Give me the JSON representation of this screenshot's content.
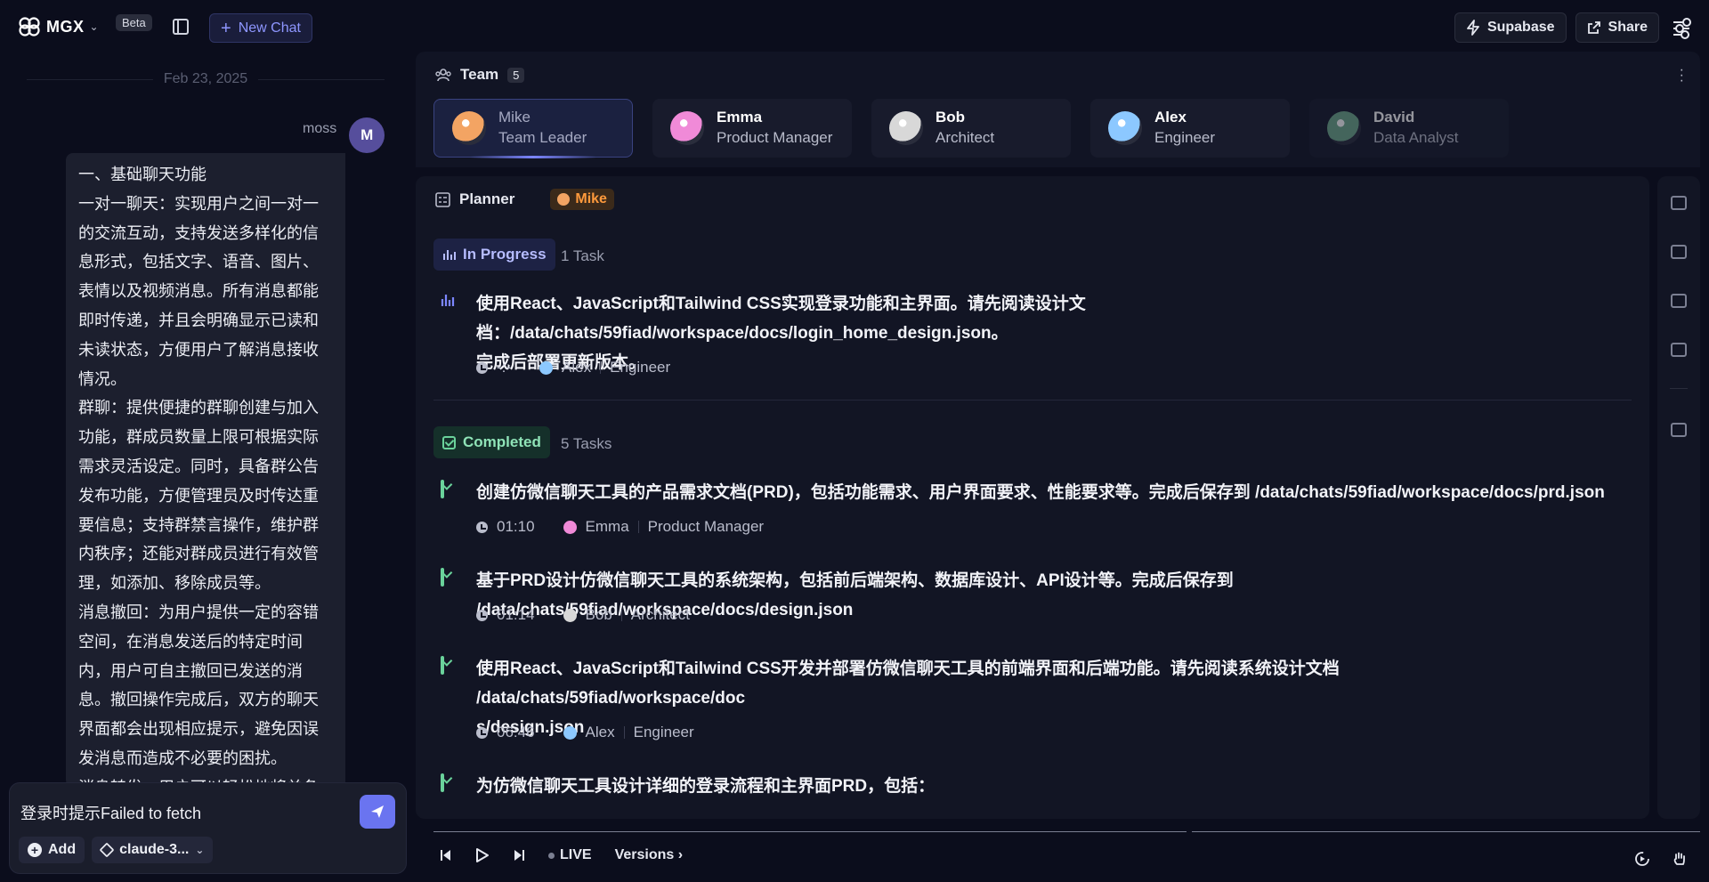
{
  "app": {
    "logo": "MGX",
    "beta": "Beta",
    "new_chat": "New Chat",
    "supabase": "Supabase",
    "share": "Share"
  },
  "chat": {
    "date": "Feb 23, 2025",
    "user_name": "moss",
    "avatar_initial": "M",
    "message_lines": [
      "一、基础聊天功能",
      "一对一聊天：实现用户之间一对一",
      "的交流互动，支持发送多样化的信",
      "息形式，包括文字、语音、图片、",
      "表情以及视频消息。所有消息都能",
      "即时传递，并且会明确显示已读和",
      "未读状态，方便用户了解消息接收",
      "情况。",
      "群聊：提供便捷的群聊创建与加入",
      "功能，群成员数量上限可根据实际",
      "需求灵活设定。同时，具备群公告",
      "发布功能，方便管理员及时传达重",
      "要信息；支持群禁言操作，维护群",
      "内秩序；还能对群成员进行有效管",
      "理，如添加、移除成员等。",
      "消息撤回：为用户提供一定的容错",
      "空间，在消息发送后的特定时间",
      "内，用户可自主撤回已发送的消",
      "息。撤回操作完成后，双方的聊天",
      "界面都会出现相应提示，避免因误",
      "发消息而造成不必要的困扰。",
      "消息转发：用户可以轻松地将单条"
    ],
    "composer_text": "登录时提示Failed to fetch",
    "add_label": "Add",
    "model_label": "claude-3..."
  },
  "team": {
    "title": "Team",
    "count": "5",
    "members": [
      {
        "name": "Mike",
        "role": "Team Leader",
        "color": "#f3a463"
      },
      {
        "name": "Emma",
        "role": "Product Manager",
        "color": "#f08ad8"
      },
      {
        "name": "Bob",
        "role": "Architect",
        "color": "#d8d8d8"
      },
      {
        "name": "Alex",
        "role": "Engineer",
        "color": "#8cc8ff"
      },
      {
        "name": "David",
        "role": "Data Analyst",
        "color": "#6fa88a"
      }
    ]
  },
  "planner": {
    "title": "Planner",
    "owner": "Mike",
    "in_progress": {
      "label": "In Progress",
      "count": "1 Task",
      "tasks": [
        {
          "lines": [
            "使用React、JavaScript和Tailwind CSS实现登录功能和主界面。请先阅读设计文档：/data/chats/59fiad/workspace/docs/login_home_design.json。",
            "完成后部署更新版本。"
          ],
          "time": "-:-",
          "assignee": "Alex",
          "role": "Engineer"
        }
      ]
    },
    "completed": {
      "label": "Completed",
      "count": "5 Tasks",
      "tasks": [
        {
          "lines": [
            "创建仿微信聊天工具的产品需求文档(PRD)，包括功能需求、用户界面要求、性能要求等。完成后保存到 /data/chats/59fiad/workspace/docs/prd.json"
          ],
          "time": "01:10",
          "assignee": "Emma",
          "role": "Product Manager"
        },
        {
          "lines": [
            "基于PRD设计仿微信聊天工具的系统架构，包括前后端架构、数据库设计、API设计等。完成后保存到 /data/chats/59fiad/workspace/docs/design.json"
          ],
          "time": "01:14",
          "assignee": "Bob",
          "role": "Architect"
        },
        {
          "lines": [
            "使用React、JavaScript和Tailwind CSS开发并部署仿微信聊天工具的前端界面和后端功能。请先阅读系统设计文档 /data/chats/59fiad/workspace/doc",
            "s/design.json"
          ],
          "time": "06:46",
          "assignee": "Alex",
          "role": "Engineer"
        },
        {
          "lines": [
            "为仿微信聊天工具设计详细的登录流程和主界面PRD，包括："
          ],
          "time": "",
          "assignee": "",
          "role": ""
        }
      ]
    }
  },
  "player": {
    "live": "LIVE",
    "versions": "Versions"
  },
  "colors": {
    "accent": "#6a74f0",
    "completed": "#6ad29b",
    "owner_chip": "#ff9a3c"
  }
}
